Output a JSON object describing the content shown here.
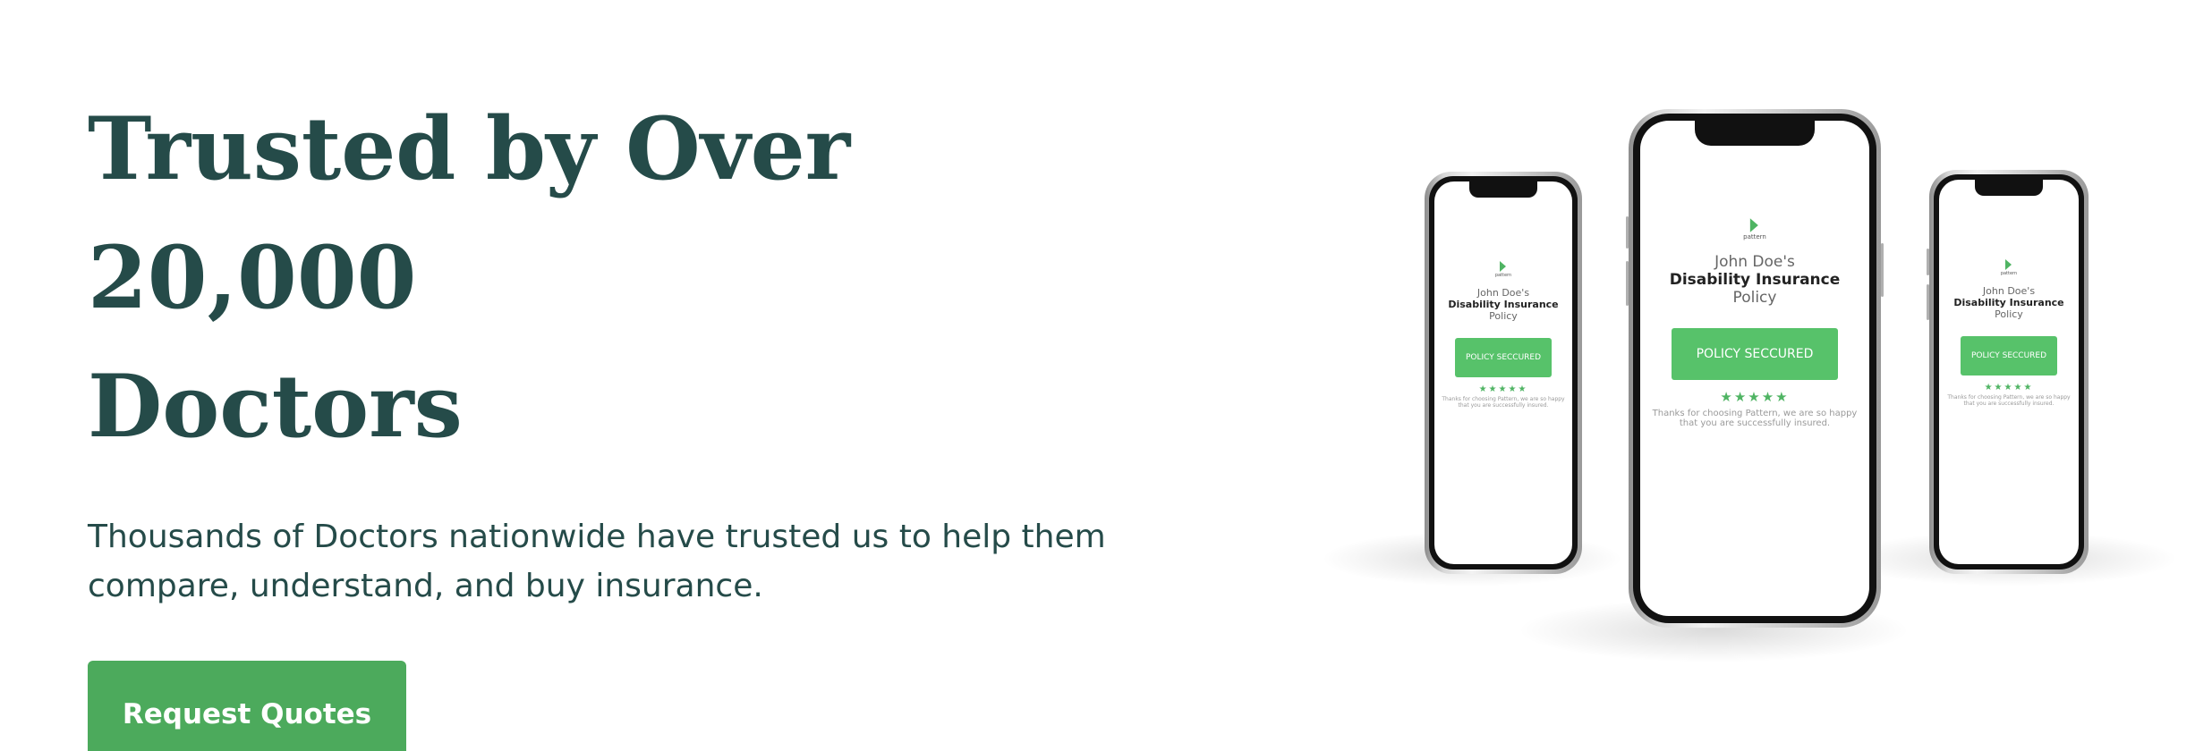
{
  "hero": {
    "headline_line1": "Trusted by Over 20,000",
    "headline_line2": "Doctors",
    "subtext": "Thousands of Doctors nationwide have trusted us to help them compare, understand, and buy insurance.",
    "cta_label": "Request Quotes"
  },
  "phone_screen": {
    "logo_text": "pattern",
    "name_line": "John Doe's",
    "title_line": "Disability Insurance",
    "policy_line": "Policy",
    "button_label": "POLICY SECCURED",
    "stars": "★★★★★",
    "thanks_line1": "Thanks for choosing Pattern, we are so happy",
    "thanks_line2": "that you are successfully insured."
  },
  "colors": {
    "heading": "#254b49",
    "accent": "#4caa5c",
    "button_text": "#ffffff"
  }
}
